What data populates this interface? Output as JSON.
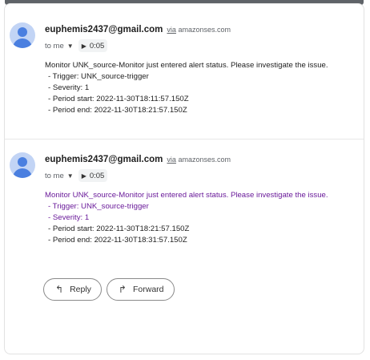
{
  "messages": [
    {
      "sender": "euphemis2437@gmail.com",
      "via_label": "via",
      "via_domain": "amazonses.com",
      "recipient": "to me",
      "duration": "0:05",
      "body": {
        "line1": "Monitor UNK_source-Monitor just entered alert status. Please investigate the issue.",
        "trigger": "- Trigger: UNK_source-trigger",
        "severity": "- Severity: 1",
        "period_start": "- Period start: 2022-11-30T18:11:57.150Z",
        "period_end": "- Period end: 2022-11-30T18:21:57.150Z"
      }
    },
    {
      "sender": "euphemis2437@gmail.com",
      "via_label": "via",
      "via_domain": "amazonses.com",
      "recipient": "to me",
      "duration": "0:05",
      "body": {
        "line1": "Monitor UNK_source-Monitor just entered alert status. Please investigate the issue.",
        "trigger": "- Trigger: UNK_source-trigger",
        "severity": "- Severity: 1",
        "period_start": "- Period start: 2022-11-30T18:21:57.150Z",
        "period_end": "- Period end: 2022-11-30T18:31:57.150Z"
      }
    }
  ],
  "actions": {
    "reply_label": "Reply",
    "forward_label": "Forward"
  },
  "icons": {
    "avatar": "person-icon",
    "caret": "caret-down-icon",
    "play": "play-icon",
    "reply": "reply-arrow-icon",
    "forward": "forward-arrow-icon"
  },
  "colors": {
    "avatar_bg": "#c2d4f5",
    "avatar_fg": "#4a7fe0",
    "quoted_text": "#6a1b9a"
  }
}
